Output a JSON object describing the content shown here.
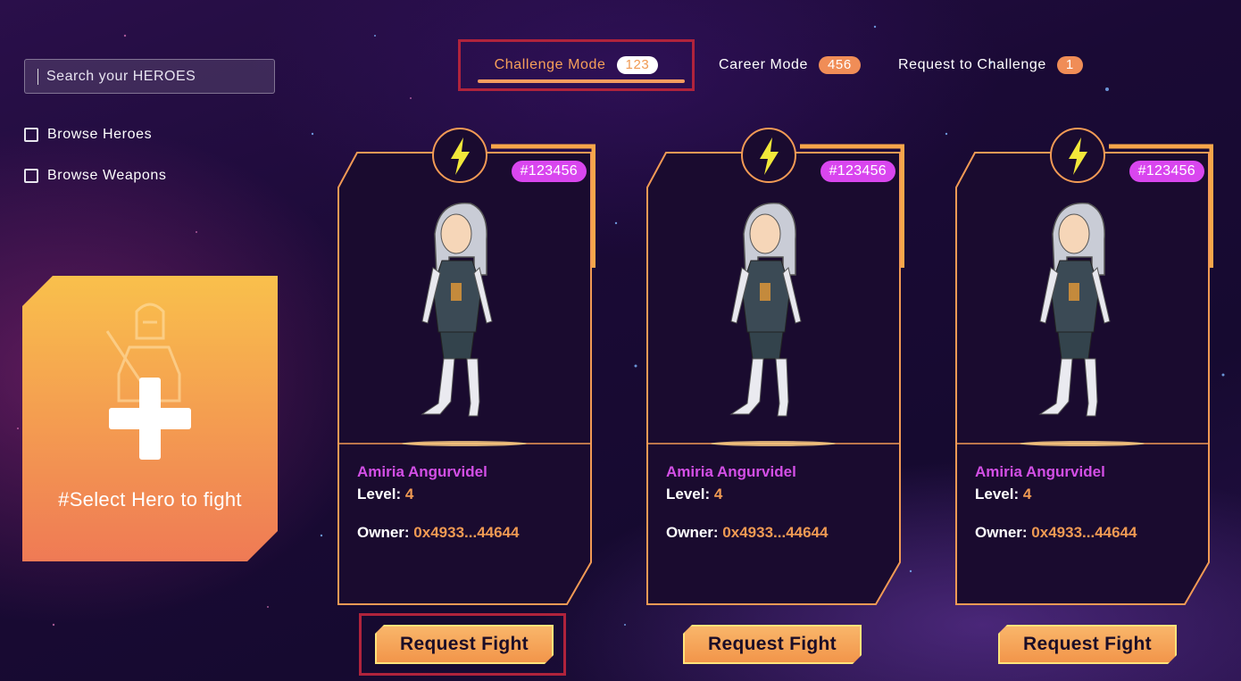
{
  "search": {
    "placeholder": "Search your HEROES"
  },
  "filters": [
    {
      "label": "Browse Heroes"
    },
    {
      "label": "Browse Weapons"
    }
  ],
  "tabs": [
    {
      "label": "Challenge Mode",
      "count": "123"
    },
    {
      "label": "Career Mode",
      "count": "456"
    },
    {
      "label": "Request to Challenge",
      "count": "1"
    }
  ],
  "select_hero": {
    "label": "#Select Hero to fight"
  },
  "heroes": [
    {
      "id": "#123456",
      "name": "Amiria Angurvidel",
      "level_label": "Level:",
      "level": "4",
      "owner_label": "Owner:",
      "owner": "0x4933...44644",
      "button": "Request Fight"
    },
    {
      "id": "#123456",
      "name": "Amiria Angurvidel",
      "level_label": "Level:",
      "level": "4",
      "owner_label": "Owner:",
      "owner": "0x4933...44644",
      "button": "Request Fight"
    },
    {
      "id": "#123456",
      "name": "Amiria Angurvidel",
      "level_label": "Level:",
      "level": "4",
      "owner_label": "Owner:",
      "owner": "0x4933...44644",
      "button": "Request Fight"
    }
  ],
  "colors": {
    "accent_orange": "#f09a53",
    "name_magenta": "#d34fe6",
    "badge_pink": "#d946ef",
    "highlight_red": "#b0233c"
  }
}
